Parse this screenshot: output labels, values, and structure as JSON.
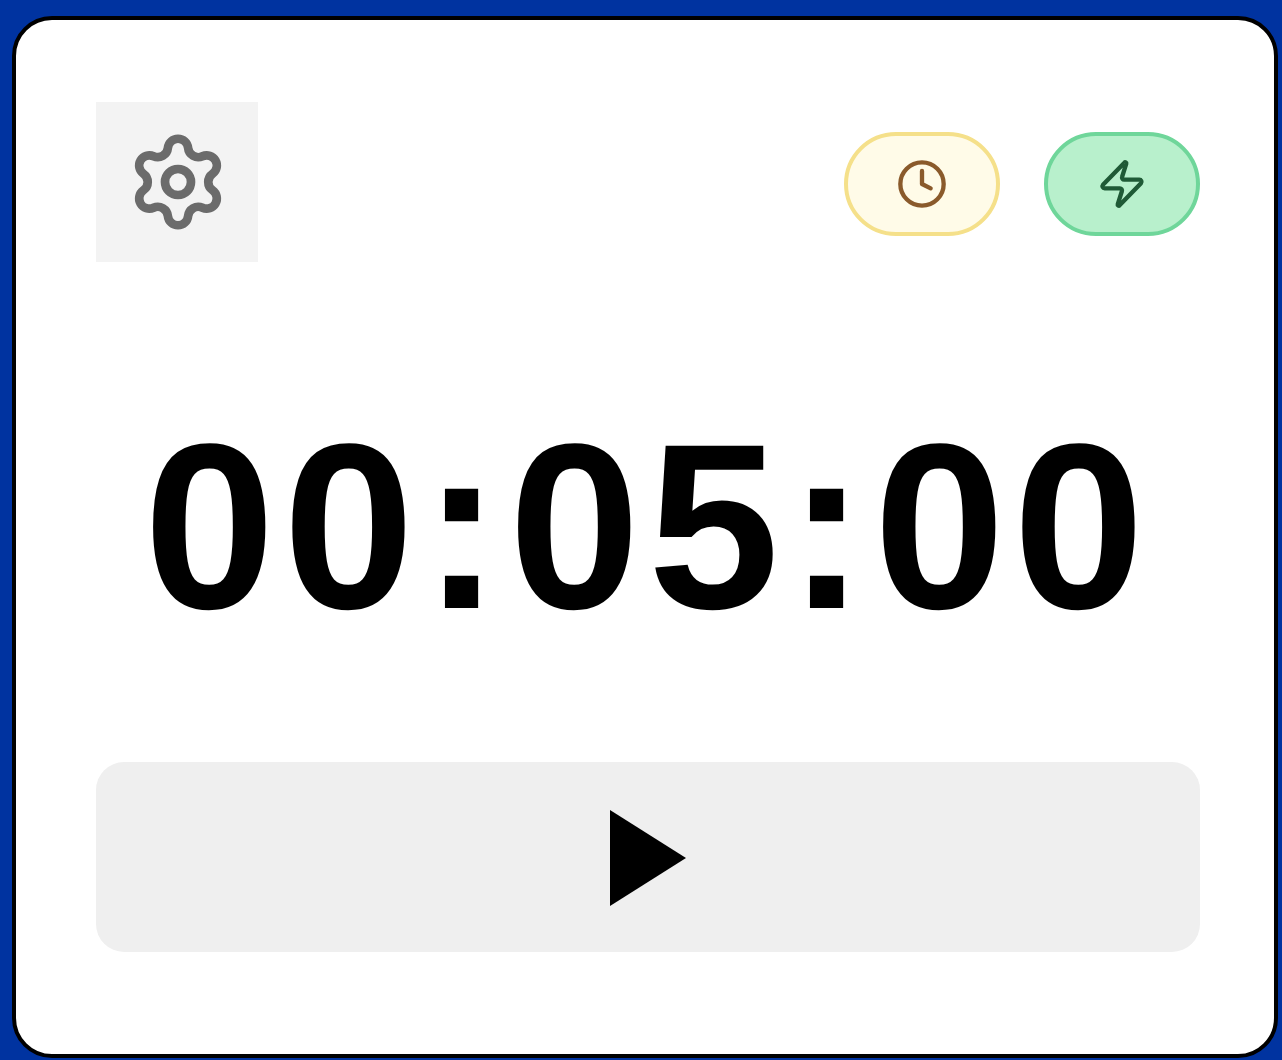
{
  "toolbar": {
    "modes": [
      {
        "kind": "clock"
      },
      {
        "kind": "bolt"
      }
    ]
  },
  "timer": {
    "display": "00:05:00"
  }
}
